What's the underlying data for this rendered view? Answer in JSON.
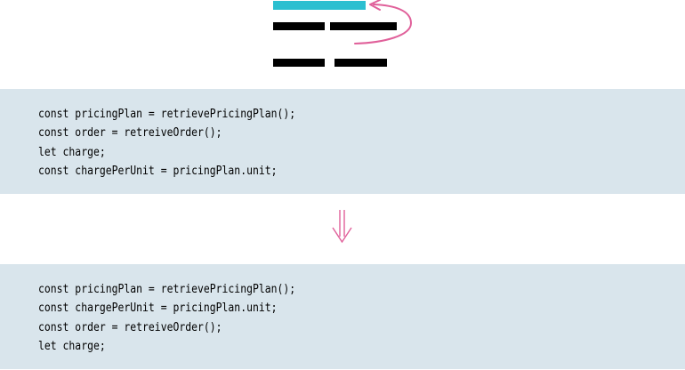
{
  "colors": {
    "highlight_bar": "#2bbfd0",
    "plain_bar": "#000000",
    "move_arrow": "#e0609a",
    "down_arrow": "#e0609a",
    "code_background": "#d9e5ec"
  },
  "icons": {
    "top": "slide-statements-icon",
    "transition": "double-down-arrow-icon"
  },
  "before": {
    "lines": [
      "const pricingPlan = retrievePricingPlan();",
      "const order = retreiveOrder();",
      "let charge;",
      "const chargePerUnit = pricingPlan.unit;"
    ]
  },
  "after": {
    "lines": [
      "const pricingPlan = retrievePricingPlan();",
      "const chargePerUnit = pricingPlan.unit;",
      "const order = retreiveOrder();",
      "let charge;"
    ]
  }
}
